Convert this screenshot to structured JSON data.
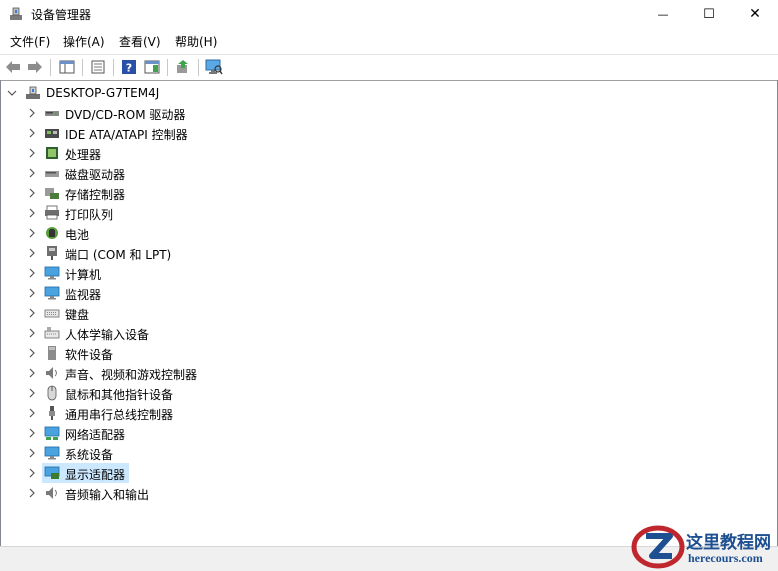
{
  "window": {
    "title": "设备管理器",
    "minimize": "—",
    "maximize": "☐",
    "close": "✕"
  },
  "menu": [
    "文件(F)",
    "操作(A)",
    "查看(V)",
    "帮助(H)"
  ],
  "tree": {
    "root": "DESKTOP-G7TEM4J",
    "items": [
      {
        "label": "DVD/CD-ROM 驱动器",
        "icon": "dvd-drive-icon"
      },
      {
        "label": "IDE ATA/ATAPI 控制器",
        "icon": "ide-controller-icon"
      },
      {
        "label": "处理器",
        "icon": "processor-icon"
      },
      {
        "label": "磁盘驱动器",
        "icon": "disk-drive-icon"
      },
      {
        "label": "存储控制器",
        "icon": "storage-controller-icon"
      },
      {
        "label": "打印队列",
        "icon": "printer-icon"
      },
      {
        "label": "电池",
        "icon": "battery-icon"
      },
      {
        "label": "端口 (COM 和 LPT)",
        "icon": "port-icon"
      },
      {
        "label": "计算机",
        "icon": "computer-icon"
      },
      {
        "label": "监视器",
        "icon": "monitor-icon"
      },
      {
        "label": "键盘",
        "icon": "keyboard-icon"
      },
      {
        "label": "人体学输入设备",
        "icon": "hid-icon"
      },
      {
        "label": "软件设备",
        "icon": "software-device-icon"
      },
      {
        "label": "声音、视频和游戏控制器",
        "icon": "sound-icon"
      },
      {
        "label": "鼠标和其他指针设备",
        "icon": "mouse-icon"
      },
      {
        "label": "通用串行总线控制器",
        "icon": "usb-icon"
      },
      {
        "label": "网络适配器",
        "icon": "network-adapter-icon"
      },
      {
        "label": "系统设备",
        "icon": "system-device-icon"
      },
      {
        "label": "显示适配器",
        "icon": "display-adapter-icon",
        "selected": true
      },
      {
        "label": "音频输入和输出",
        "icon": "audio-io-icon"
      }
    ]
  },
  "watermark": {
    "brand": "这里教程网",
    "site": "herecours.com"
  },
  "colors": {
    "selection": "#cce8ff",
    "watermark_red": "#c0262d",
    "watermark_blue": "#1d4f91"
  }
}
